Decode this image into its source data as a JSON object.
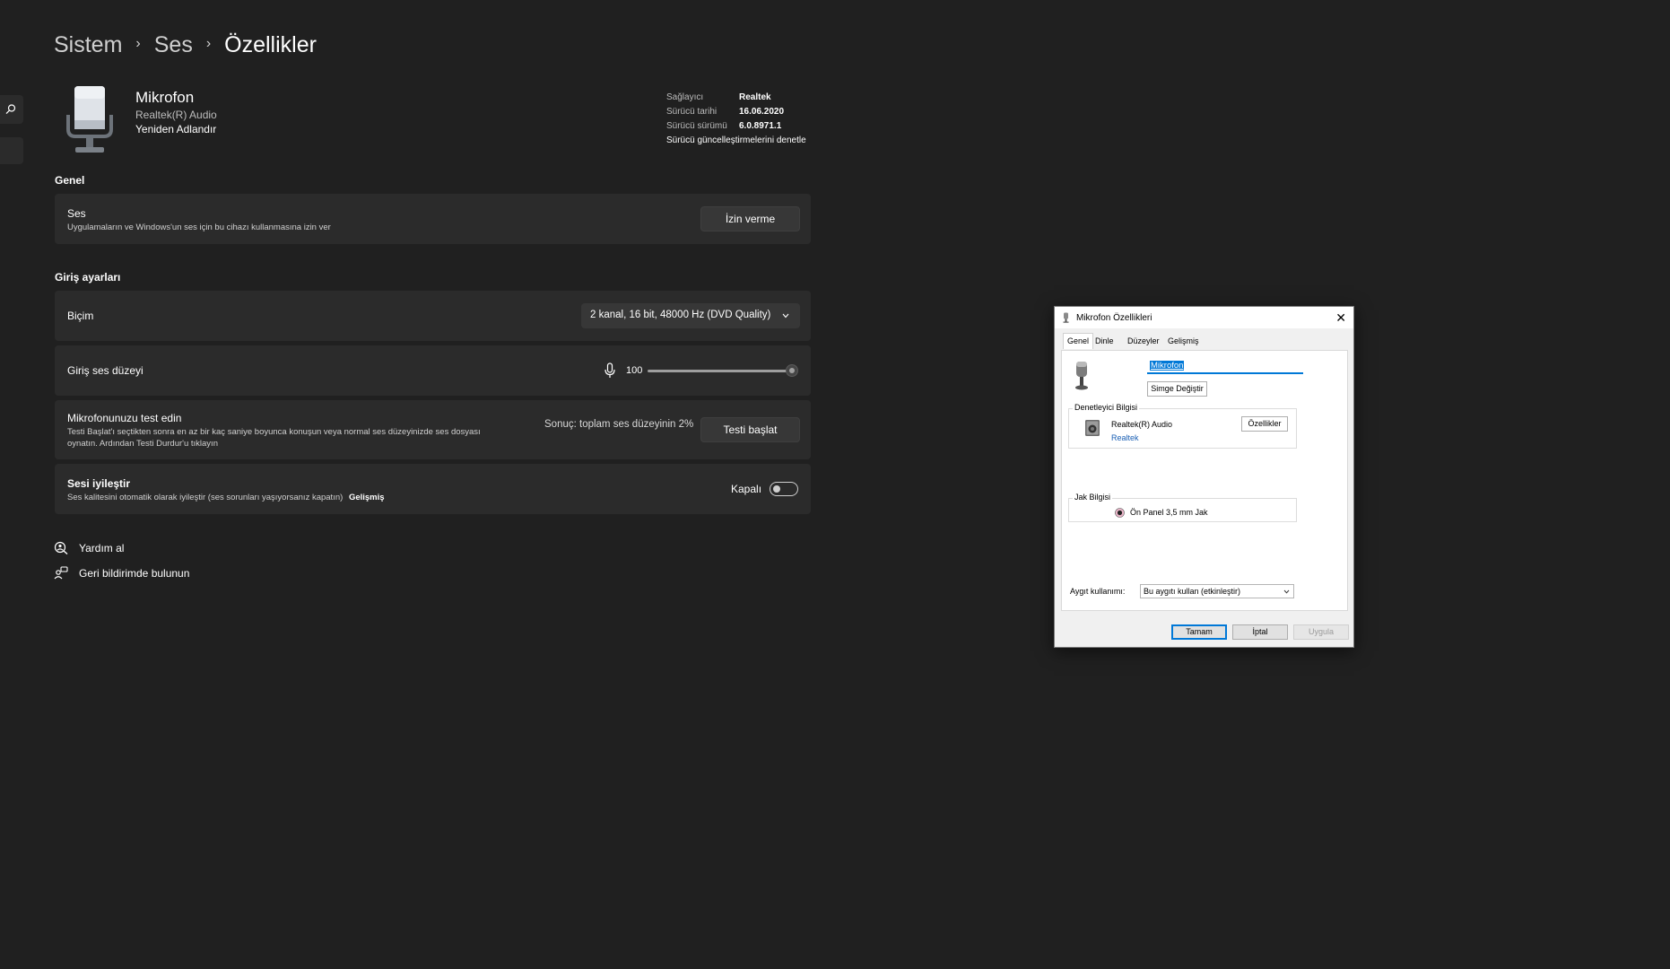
{
  "breadcrumb": [
    "Sistem",
    "Ses",
    "Özellikler"
  ],
  "device": {
    "name": "Mikrofon",
    "driver_name": "Realtek(R) Audio",
    "rename_label": "Yeniden Adlandır"
  },
  "driver_info": {
    "provider_label": "Sağlayıcı",
    "provider_value": "Realtek",
    "date_label": "Sürücü tarihi",
    "date_value": "16.06.2020",
    "version_label": "Sürücü sürümü",
    "version_value": "6.0.8971.1",
    "update_link": "Sürücü güncelleştirmelerini denetle"
  },
  "general": {
    "section_title": "Genel",
    "audio_title": "Ses",
    "audio_desc": "Uygulamaların ve Windows'un ses için bu cihazı kullanmasına izin ver",
    "deny_button": "İzin verme"
  },
  "input_settings": {
    "section_title": "Giriş ayarları",
    "format_label": "Biçim",
    "format_value": "2 kanal, 16 bit, 48000 Hz (DVD Quality)",
    "volume_label": "Giriş ses düzeyi",
    "volume_value": "100",
    "volume_level": 1.0,
    "test_title": "Mikrofonunuzu test edin",
    "test_desc_line1": "Testi Başlat'ı seçtikten sonra en az bir kaç saniye boyunca konuşun veya normal ses düzeyinizde ses dosyası",
    "test_desc_line2": "oynatın. Ardından Testi Durdur'u tıklayın",
    "test_result": "Sonuç: toplam ses düzeyinin 2%",
    "test_button": "Testi başlat",
    "enhance_title": "Sesi iyileştir",
    "enhance_desc": "Ses kalitesini otomatik olarak iyileştir (ses sorunları yaşıyorsanız kapatın)",
    "enhance_link": "Gelişmiş",
    "enhance_state": "Kapalı"
  },
  "footer_links": {
    "help": "Yardım al",
    "feedback": "Geri bildirimde bulunun"
  },
  "dialog": {
    "title": "Mikrofon Özellikleri",
    "tabs": [
      "Genel",
      "Dinle",
      "Düzeyler",
      "Gelişmiş"
    ],
    "name_value": "Mikrofon",
    "change_icon_button": "Simge Değiştir",
    "controller_group": "Denetleyici Bilgisi",
    "controller_name": "Realtek(R) Audio",
    "controller_vendor": "Realtek",
    "properties_button": "Özellikler",
    "jack_group": "Jak Bilgisi",
    "jack_value": "Ön Panel 3,5 mm Jak",
    "usage_label": "Aygıt kullanımı:",
    "usage_value": "Bu aygıtı kullan (etkinleştir)",
    "ok_button": "Tamam",
    "cancel_button": "İptal",
    "apply_button": "Uygula"
  },
  "colors": {
    "background": "#202020",
    "card": "#2b2b2b",
    "selection": "#0078d7",
    "link_blue": "#1a5fb4"
  }
}
